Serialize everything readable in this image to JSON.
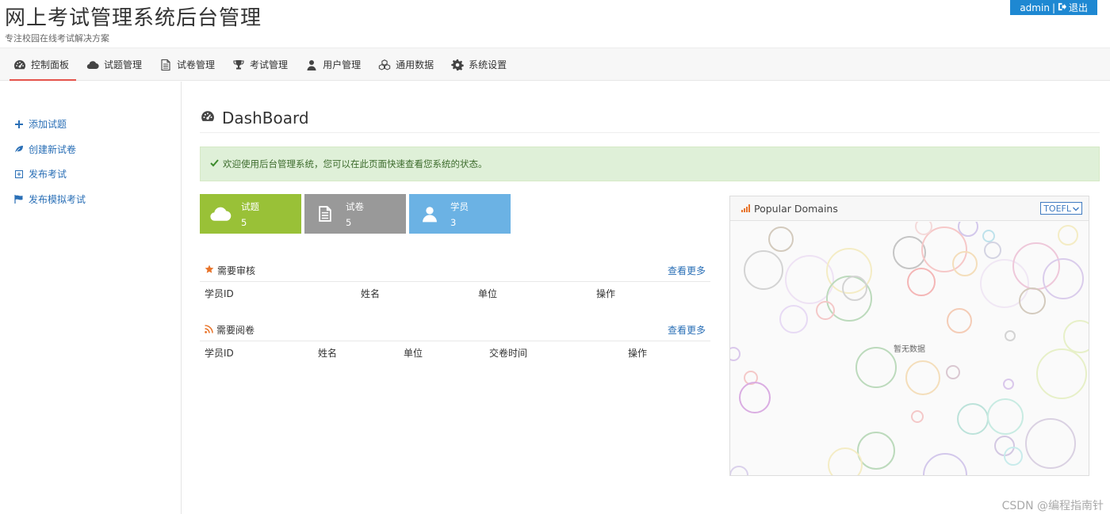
{
  "header": {
    "title": "网上考试管理系统后台管理",
    "subtitle": "专注校园在线考试解决方案",
    "user": "admin",
    "separator": "|",
    "logout": "退出"
  },
  "nav": [
    {
      "label": "控制面板",
      "icon": "dashboard-icon",
      "active": true
    },
    {
      "label": "试题管理",
      "icon": "cloud-icon"
    },
    {
      "label": "试卷管理",
      "icon": "file-icon"
    },
    {
      "label": "考试管理",
      "icon": "trophy-icon"
    },
    {
      "label": "用户管理",
      "icon": "user-icon"
    },
    {
      "label": "通用数据",
      "icon": "cubes-icon"
    },
    {
      "label": "系统设置",
      "icon": "gear-icon"
    }
  ],
  "sidebar": {
    "items": [
      {
        "label": "添加试题",
        "icon": "plus-icon"
      },
      {
        "label": "创建新试卷",
        "icon": "leaf-icon"
      },
      {
        "label": "发布考试",
        "icon": "plus-square-icon"
      },
      {
        "label": "发布模拟考试",
        "icon": "flag-icon"
      }
    ]
  },
  "page": {
    "title": "DashBoard",
    "alert": "欢迎使用后台管理系统，您可以在此页面快速查看您系统的状态。"
  },
  "stats": [
    {
      "label": "试题",
      "value": "5",
      "icon": "cloud-icon",
      "color": "#99c137"
    },
    {
      "label": "试卷",
      "value": "5",
      "icon": "file-icon",
      "color": "#999999"
    },
    {
      "label": "学员",
      "value": "3",
      "icon": "user-icon",
      "color": "#6bb2e4"
    }
  ],
  "review": {
    "title": "需要审核",
    "more": "查看更多",
    "columns": [
      "学员ID",
      "姓名",
      "单位",
      "操作"
    ]
  },
  "grading": {
    "title": "需要阅卷",
    "more": "查看更多",
    "columns": [
      "学员ID",
      "姓名",
      "单位",
      "交卷时间",
      "操作"
    ]
  },
  "widget": {
    "title": "Popular Domains",
    "selected": "TOEFL",
    "empty": "暂无数据"
  },
  "watermark": "CSDN @编程指南针",
  "colors": {
    "accent": "#1e88d2",
    "nav_active": "#e5534b",
    "link": "#2a6fb6",
    "alert_bg": "#dff0d8",
    "green": "#99c137",
    "gray": "#999999",
    "blue": "#6bb2e4"
  }
}
